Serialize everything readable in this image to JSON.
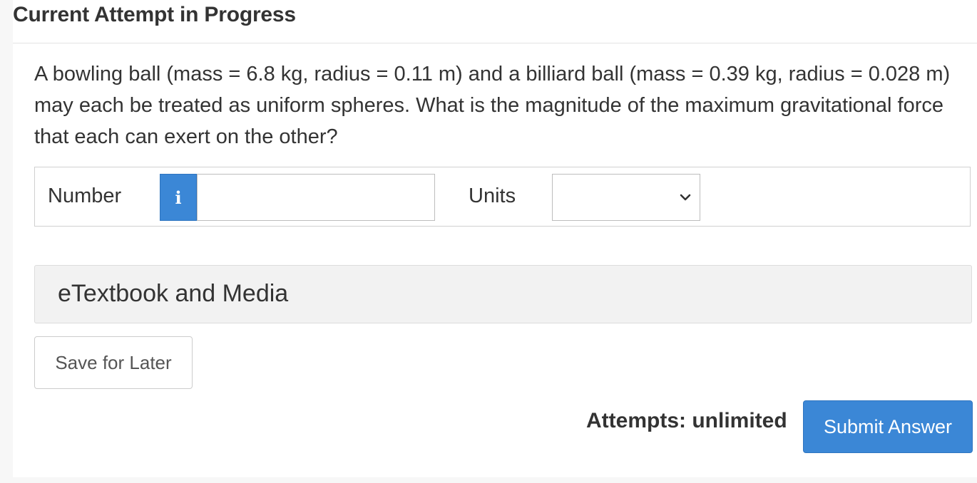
{
  "header": {
    "title": "Current Attempt in Progress"
  },
  "question": {
    "text": "A bowling ball (mass = 6.8 kg, radius = 0.11 m) and a billiard ball (mass = 0.39 kg, radius = 0.028 m) may each be treated as uniform spheres. What is the magnitude of the maximum gravitational force that each can exert on the other?"
  },
  "answer": {
    "number_label": "Number",
    "info_icon": "info-icon",
    "info_glyph": "i",
    "number_value": "",
    "units_label": "Units",
    "units_selected": ""
  },
  "etextbook": {
    "label": "eTextbook and Media"
  },
  "actions": {
    "save_label": "Save for Later",
    "attempts_text": "Attempts: unlimited",
    "submit_label": "Submit Answer"
  },
  "colors": {
    "accent": "#3b87d6",
    "text": "#333333",
    "panel_bg": "#f2f2f2"
  }
}
